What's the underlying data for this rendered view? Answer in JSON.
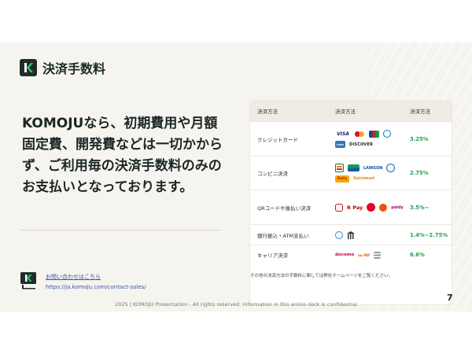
{
  "header": {
    "logo_letter": "K",
    "title": "決済手数料"
  },
  "headline": "KOMOJUなら、初期費用や月額固定費、開発費などは一切かからず、ご利用毎の決済手数料のみのお支払いとなっております。",
  "contact": {
    "link_text": "お問い合わせはこちら",
    "url": "https://ja.komoju.com/contact-sales/"
  },
  "table": {
    "headers": [
      "決済方法",
      "決済方法",
      "決済方法"
    ],
    "rows": [
      {
        "method": "クレジットカード",
        "fee": "3.25%",
        "logos": [
          "VISA",
          "Mastercard",
          "JCB",
          "Diners",
          "AMEX",
          "DISCOVER"
        ]
      },
      {
        "method": "コンビニ決済",
        "fee": "2.75%",
        "logos": [
          "7-Eleven",
          "FamilyMart",
          "LAWSON",
          "MINISTOP",
          "Daily",
          "Seicomart"
        ]
      },
      {
        "method": "QRコードや後払い決済",
        "fee": "3.5%~",
        "logos": [
          "PayPay",
          "R Pay",
          "merpay",
          "au PAY",
          "paidy"
        ]
      },
      {
        "method": "銀行振込・ATM支払い",
        "fee": "1.4%~2.75%",
        "logos": [
          "Pay-easy",
          "Bank"
        ]
      },
      {
        "method": "キャリア決済",
        "fee": "6.6%",
        "logos": [
          "docomo",
          "au PAY",
          "SoftBank"
        ]
      }
    ]
  },
  "footnote": "その他の決済方法の手数料に関しては弊社ホームページをご覧ください。",
  "footer": "2025 | KOMOJU Presentation - All rights reserved. Information in this entire deck is confidential",
  "page_number": "7",
  "colors": {
    "background": "#f6f4ef",
    "brand_dark": "#1f2d2a",
    "brand_green": "#2ecc71",
    "fee_green": "#2e9a4b",
    "link_blue": "#3a55a8"
  }
}
